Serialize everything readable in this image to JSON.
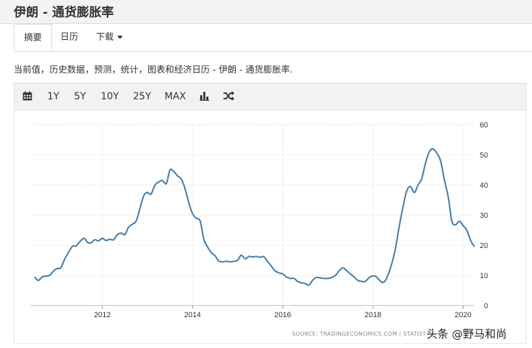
{
  "header": {
    "title": "伊朗 - 通货膨胀率"
  },
  "tabs": [
    {
      "label": "摘要",
      "active": true
    },
    {
      "label": "日历"
    },
    {
      "label": "下载",
      "has_dropdown": true
    }
  ],
  "description": "当前值，历史数据，预测，统计，图表和经济日历 - 伊朗 - 通货膨胀率.",
  "toolbar": {
    "calendar_icon": "calendar-icon",
    "ranges": [
      "1Y",
      "5Y",
      "10Y",
      "25Y",
      "MAX"
    ],
    "chart_type_icon": "bar-chart-icon",
    "compare_icon": "shuffle-icon"
  },
  "chart_data": {
    "type": "line",
    "title": "",
    "xlabel": "",
    "ylabel": "",
    "x_ticks": [
      "2012",
      "2014",
      "2016",
      "2018",
      "2020"
    ],
    "y_ticks": [
      "0",
      "10",
      "20",
      "30",
      "40",
      "50",
      "60"
    ],
    "ylim": [
      0,
      60
    ],
    "xlim": [
      2010.4,
      2020.25
    ],
    "y_axis_side": "right",
    "grid": true,
    "series": [
      {
        "color": "#4a7fab",
        "points": [
          [
            2010.5,
            9.5
          ],
          [
            2010.58,
            8.3
          ],
          [
            2010.67,
            9.5
          ],
          [
            2010.83,
            10.0
          ],
          [
            2010.92,
            11.5
          ],
          [
            2011.0,
            12.3
          ],
          [
            2011.08,
            12.5
          ],
          [
            2011.17,
            15.5
          ],
          [
            2011.33,
            19.5
          ],
          [
            2011.42,
            19.8
          ],
          [
            2011.58,
            22.3
          ],
          [
            2011.67,
            21.0
          ],
          [
            2011.75,
            20.8
          ],
          [
            2011.83,
            21.8
          ],
          [
            2011.92,
            21.5
          ],
          [
            2012.0,
            22.3
          ],
          [
            2012.08,
            21.6
          ],
          [
            2012.17,
            22.0
          ],
          [
            2012.25,
            21.8
          ],
          [
            2012.33,
            23.5
          ],
          [
            2012.42,
            24.0
          ],
          [
            2012.5,
            23.5
          ],
          [
            2012.58,
            26.0
          ],
          [
            2012.67,
            27.0
          ],
          [
            2012.75,
            28.0
          ],
          [
            2012.83,
            32.0
          ],
          [
            2012.92,
            36.5
          ],
          [
            2013.0,
            37.5
          ],
          [
            2013.08,
            37.0
          ],
          [
            2013.17,
            40.0
          ],
          [
            2013.25,
            41.0
          ],
          [
            2013.33,
            41.5
          ],
          [
            2013.42,
            40.5
          ],
          [
            2013.5,
            45.0
          ],
          [
            2013.58,
            44.5
          ],
          [
            2013.67,
            43.0
          ],
          [
            2013.75,
            42.0
          ],
          [
            2013.83,
            39.0
          ],
          [
            2013.92,
            34.0
          ],
          [
            2014.0,
            30.5
          ],
          [
            2014.08,
            29.0
          ],
          [
            2014.17,
            28.0
          ],
          [
            2014.25,
            22.0
          ],
          [
            2014.33,
            19.5
          ],
          [
            2014.42,
            17.5
          ],
          [
            2014.5,
            16.5
          ],
          [
            2014.58,
            14.8
          ],
          [
            2014.67,
            14.5
          ],
          [
            2014.75,
            14.7
          ],
          [
            2014.83,
            14.5
          ],
          [
            2014.92,
            14.7
          ],
          [
            2015.0,
            15.0
          ],
          [
            2015.08,
            16.7
          ],
          [
            2015.17,
            15.5
          ],
          [
            2015.25,
            16.3
          ],
          [
            2015.33,
            16.1
          ],
          [
            2015.42,
            16.3
          ],
          [
            2015.5,
            16.0
          ],
          [
            2015.58,
            16.2
          ],
          [
            2015.67,
            14.5
          ],
          [
            2015.75,
            13.0
          ],
          [
            2015.83,
            11.5
          ],
          [
            2015.92,
            10.8
          ],
          [
            2016.0,
            10.5
          ],
          [
            2016.08,
            9.5
          ],
          [
            2016.17,
            9.0
          ],
          [
            2016.25,
            9.0
          ],
          [
            2016.33,
            8.0
          ],
          [
            2016.42,
            7.5
          ],
          [
            2016.5,
            7.3
          ],
          [
            2016.58,
            6.8
          ],
          [
            2016.67,
            8.5
          ],
          [
            2016.75,
            9.3
          ],
          [
            2016.83,
            9.2
          ],
          [
            2016.92,
            9.0
          ],
          [
            2017.0,
            9.0
          ],
          [
            2017.08,
            9.3
          ],
          [
            2017.17,
            10.0
          ],
          [
            2017.25,
            11.5
          ],
          [
            2017.33,
            12.5
          ],
          [
            2017.42,
            11.5
          ],
          [
            2017.5,
            10.5
          ],
          [
            2017.58,
            9.5
          ],
          [
            2017.67,
            8.3
          ],
          [
            2017.75,
            8.0
          ],
          [
            2017.83,
            8.0
          ],
          [
            2017.92,
            9.3
          ],
          [
            2018.0,
            9.8
          ],
          [
            2018.08,
            9.5
          ],
          [
            2018.17,
            8.0
          ],
          [
            2018.25,
            7.8
          ],
          [
            2018.33,
            10.0
          ],
          [
            2018.42,
            14.0
          ],
          [
            2018.5,
            19.0
          ],
          [
            2018.58,
            26.0
          ],
          [
            2018.67,
            33.0
          ],
          [
            2018.75,
            38.0
          ],
          [
            2018.83,
            39.5
          ],
          [
            2018.92,
            37.5
          ],
          [
            2019.0,
            40.0
          ],
          [
            2019.08,
            42.0
          ],
          [
            2019.17,
            47.5
          ],
          [
            2019.25,
            51.0
          ],
          [
            2019.33,
            52.0
          ],
          [
            2019.42,
            50.5
          ],
          [
            2019.5,
            48.0
          ],
          [
            2019.58,
            42.0
          ],
          [
            2019.67,
            36.0
          ],
          [
            2019.75,
            28.0
          ],
          [
            2019.83,
            26.8
          ],
          [
            2019.92,
            28.0
          ],
          [
            2020.0,
            26.5
          ],
          [
            2020.08,
            25.0
          ],
          [
            2020.17,
            21.5
          ],
          [
            2020.25,
            19.5
          ]
        ]
      }
    ],
    "source": "SOURCE:  TRADINGECONOMICS.COM  |  STATISTICAL"
  },
  "watermark": "头条 @野马和尚"
}
